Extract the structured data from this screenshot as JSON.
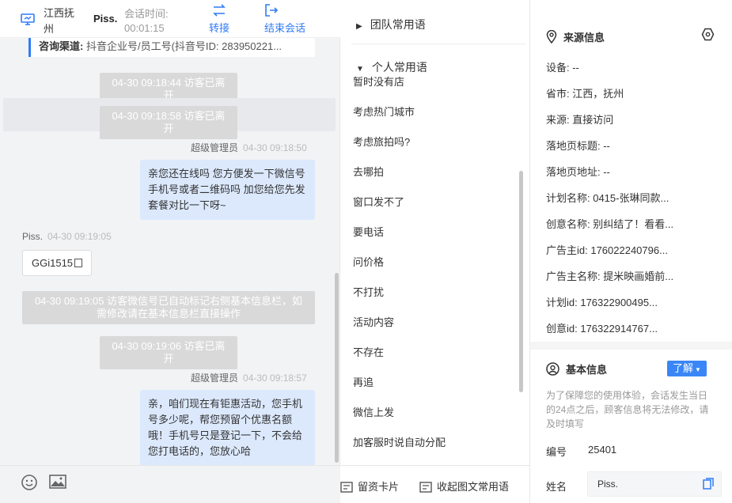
{
  "header": {
    "location": "江西抚州",
    "visitor_name": "Piss.",
    "session_time_label": "会话时间:",
    "session_time": "00:01:15",
    "transfer_label": "转接",
    "end_session_label": "结束会话"
  },
  "chat": {
    "channel_label": "咨询渠道:",
    "channel_value": "抖音企业号/员工号(抖音号ID: 283950221...",
    "messages": [
      {
        "type": "system",
        "text": "04-30 09:18:44 访客已离开"
      },
      {
        "type": "system",
        "text": "04-30 09:18:58 访客已离开"
      },
      {
        "type": "agent",
        "sender": "超级管理员",
        "time": "04-30 09:18:50",
        "text": "亲您还在线吗 您方便发一下微信号 手机号或者二维码吗 加您给您先发套餐对比一下呀~"
      },
      {
        "type": "visitor",
        "sender": "Piss.",
        "time": "04-30 09:19:05",
        "text": "GGi1515"
      },
      {
        "type": "system",
        "text": "04-30 09:19:05 访客微信号已自动标记右侧基本信息栏，如需修改请在基本信息栏直接操作"
      },
      {
        "type": "system",
        "text": "04-30 09:19:06 访客已离开"
      },
      {
        "type": "agent",
        "sender": "超级管理员",
        "time": "04-30 09:18:57",
        "text": "亲，咱们现在有钜惠活动，您手机号多少呢，帮您预留个优惠名额哦！手机号只是登记一下，不会给您打电话的，您放心哈"
      }
    ]
  },
  "toolbar": {
    "info_card_label": "留资卡片",
    "collapse_phrases_label": "收起图文常用语"
  },
  "phrases": {
    "team_group": "团队常用语",
    "personal_group": "个人常用语",
    "items": [
      "暂时没有店",
      "考虑热门城市",
      "考虑旅拍吗?",
      "去哪拍",
      "窗口发不了",
      "要电话",
      "问价格",
      "不打扰",
      "活动内容",
      "不存在",
      "再追",
      "微信上发",
      "加客服时说自动分配"
    ]
  },
  "source_info": {
    "title": "来源信息",
    "fields": [
      "设备: --",
      "省市: 江西，抚州",
      "来源: 直接访问",
      "落地页标题: --",
      "落地页地址: --",
      "计划名称: 0415-张琳同款...",
      "创意名称: 别纠结了！看看...",
      "广告主id: 176022240796...",
      "广告主名称: 提米映画婚前...",
      "计划id: 176322900495...",
      "创意id: 176322914767..."
    ]
  },
  "basic_info": {
    "title": "基本信息",
    "know_label": "了解",
    "notice": "为了保障您的使用体验，会话发生当日的24点之后，顾客信息将无法修改，请及时填写",
    "id_label": "编号",
    "id_value": "25401",
    "name_label": "姓名",
    "name_value": "Piss."
  },
  "colors": {
    "accent": "#2f7cf6",
    "agent_bubble": "#dce9fd",
    "system_msg": "#d9d9d9"
  }
}
